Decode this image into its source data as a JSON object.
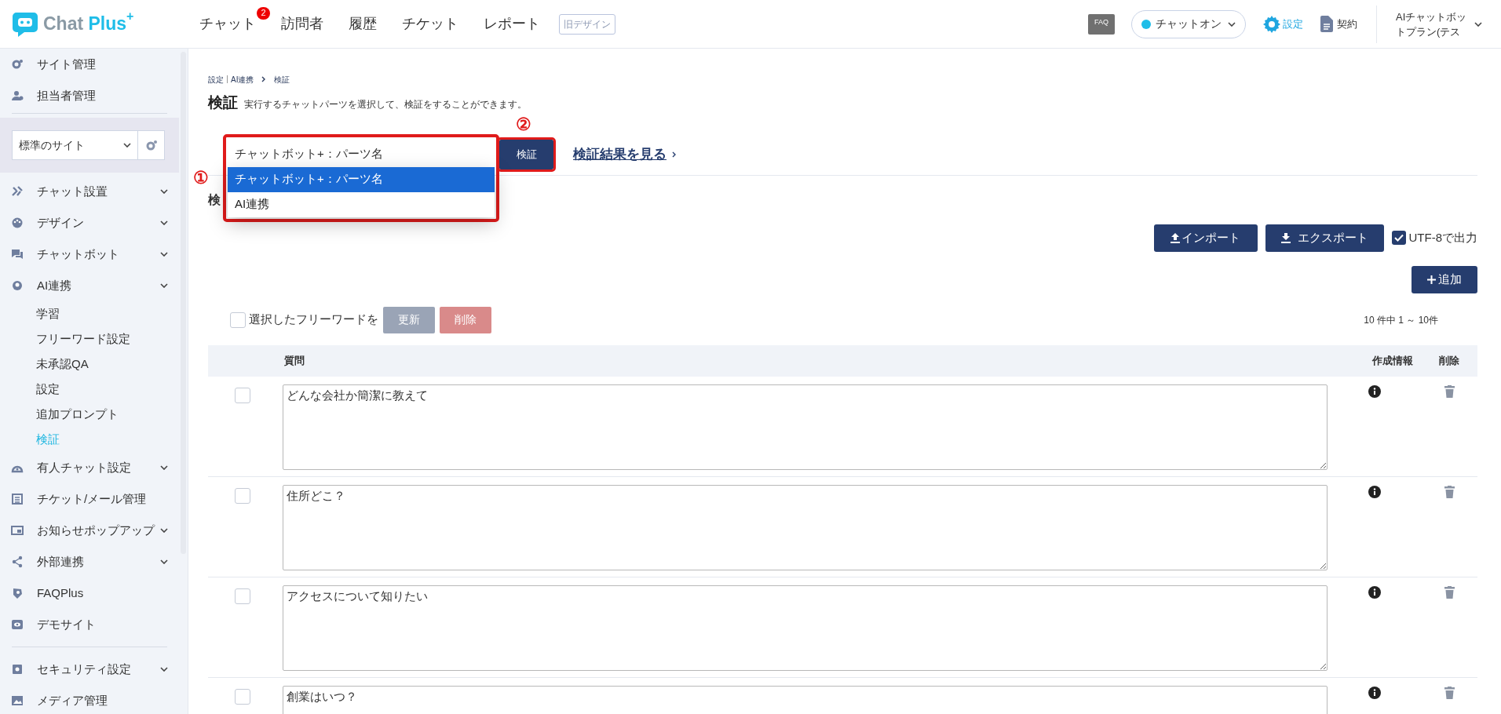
{
  "header": {
    "logo": {
      "text": "Chat Plus",
      "sup": "+"
    },
    "nav": [
      {
        "label": "チャット",
        "badge": "2",
        "selected": false
      },
      {
        "label": "訪問者",
        "selected": false
      },
      {
        "label": "履歴",
        "selected": false
      },
      {
        "label": "チケット",
        "selected": false
      },
      {
        "label": "レポート",
        "selected": false
      }
    ],
    "old_design": "旧デザイン",
    "faq": "FAQ",
    "status": {
      "label": "チャットオン",
      "color": "#1fbde8"
    },
    "settings": "設定",
    "contract": "契約",
    "plan": [
      "AIチャットボッ",
      "トプラン(テス"
    ]
  },
  "sidebar": {
    "top_items": [
      {
        "label": "サイト管理"
      },
      {
        "label": "担当者管理"
      }
    ],
    "site_select": {
      "value": "標準のサイト"
    },
    "menu": [
      {
        "label": "チャット設置",
        "has_submenu": true
      },
      {
        "label": "デザイン",
        "has_submenu": true
      },
      {
        "label": "チャットボット",
        "has_submenu": true
      },
      {
        "label": "AI連携",
        "has_submenu": true,
        "children": [
          {
            "label": "学習",
            "selected": false
          },
          {
            "label": "フリーワード設定",
            "selected": false
          },
          {
            "label": "未承認QA",
            "selected": false
          },
          {
            "label": "設定",
            "selected": false
          },
          {
            "label": "追加プロンプト",
            "selected": false
          },
          {
            "label": "検証",
            "selected": true
          }
        ]
      },
      {
        "label": "有人チャット設定",
        "has_submenu": true
      },
      {
        "label": "チケット/メール管理",
        "has_submenu": false
      },
      {
        "label": "お知らせポップアップ",
        "has_submenu": true
      },
      {
        "label": "外部連携",
        "has_submenu": true
      },
      {
        "label": "FAQPlus",
        "has_submenu": false
      },
      {
        "label": "デモサイト",
        "has_submenu": false
      }
    ],
    "bottom_menu": [
      {
        "label": "セキュリティ設定",
        "has_submenu": true
      },
      {
        "label": "メディア管理",
        "has_submenu": false
      }
    ]
  },
  "content": {
    "breadcrumb": [
      "設定",
      "AI連携",
      "検証"
    ],
    "title": "検証",
    "description": "実行するチャットパーツを選択して、検証をすることができます。",
    "select": {
      "value": "チャットボット+：パーツ名",
      "options": [
        {
          "label": "チャットボット+：パーツ名",
          "selected": true
        },
        {
          "label": "AI連携",
          "selected": false
        }
      ]
    },
    "markers": [
      "①",
      "②"
    ],
    "verify_button": "検証",
    "result_link": "検証結果を見る",
    "section_heading": "検",
    "import_button": "インポート",
    "export_button": "エクスポート",
    "utf8": {
      "label": "UTF-8で出力",
      "checked": true
    },
    "add_button": "追加",
    "bulk": {
      "label": "選択したフリーワードを",
      "checked": false,
      "update_button": "更新",
      "delete_button": "削除"
    },
    "count": "10 件中 1 ～ 10件",
    "table": {
      "columns": [
        "質問",
        "作成情報",
        "削除"
      ],
      "rows": [
        {
          "checked": false,
          "question": "どんな会社か簡潔に教えて"
        },
        {
          "checked": false,
          "question": "住所どこ？"
        },
        {
          "checked": false,
          "question": "アクセスについて知りたい"
        },
        {
          "checked": false,
          "question": "創業はいつ？"
        }
      ]
    }
  }
}
